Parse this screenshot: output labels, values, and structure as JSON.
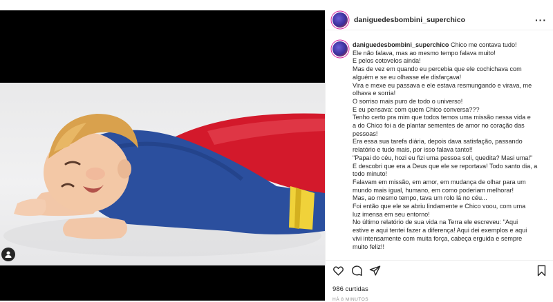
{
  "post": {
    "username": "daniguedesbombini_superchico",
    "more_icon": "more-horizontal-icon",
    "caption_lines": [
      "Chico me contava tudo!",
      "Ele não falava, mas ao mesmo tempo falava muito!",
      "E pelos cotovelos ainda!",
      "Mas de vez em quando eu percebia que ele cochichava com",
      "alguém e se eu olhasse ele disfarçava!",
      "Vira e mexe eu passava e ele estava resmungando e virava, me",
      "olhava e sorria!",
      "O sorriso mais puro de todo o universo!",
      "E eu pensava: com quem Chico conversa???",
      "Tenho certo pra mim que todos temos uma missão nessa vida e",
      "a do Chico foi a de plantar sementes de amor no coração das",
      "pessoas!",
      "Era essa sua tarefa diária, depois dava satisfação, passando",
      "relatório e tudo mais, por isso falava tanto!!",
      "\"Papai do céu, hozi eu fizi uma pessoa soli, quedita? Masi uma!\"",
      "E descobri que era a Deus que ele se reportava! Todo santo dia, a",
      "todo minuto!",
      "Falavam em missão, em amor, em mudança de olhar para um",
      "mundo mais igual, humano, em como poderiam melhorar!",
      "Mas, ao mesmo tempo, tava um rolo lá no céu...",
      "Foi então que ele se abriu lindamente e Chico voou, com uma",
      "luz imensa em seu entorno!",
      "No último relatório de sua vida na Terra ele escreveu: \"Aqui",
      "estive e aqui tentei fazer a diferença! Aqui dei exemplos e aqui",
      "vivi intensamente com muita força, cabeça erguida e sempre",
      "muito feliz!!"
    ],
    "likes": "986 curtidas",
    "time": "HÁ 8 MINUTOS"
  },
  "icons": {
    "tag": "user-tag-icon",
    "like": "heart-icon",
    "comment": "comment-icon",
    "share": "send-icon",
    "save": "bookmark-icon"
  },
  "colors": {
    "text": "#262626",
    "muted": "#8e8e8e",
    "border": "#efefef",
    "cape_red": "#d3192b",
    "shirt_blue": "#2b4f9e",
    "belt_yellow": "#f0d23a"
  }
}
